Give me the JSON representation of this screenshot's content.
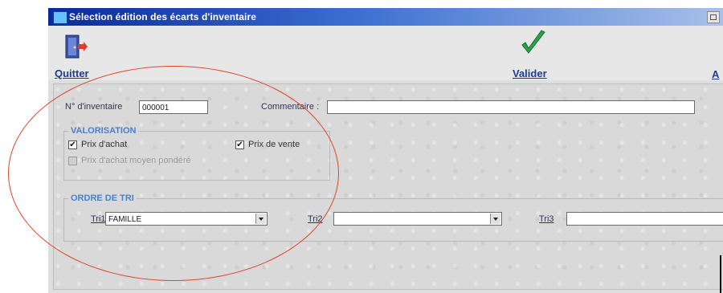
{
  "window": {
    "title": "Sélection édition des écarts d'inventaire"
  },
  "toolbar": {
    "quit_label": "Quitter",
    "quit_icon": "exit-door-icon",
    "validate_label": "Valider",
    "validate_icon": "green-checkmark-icon",
    "cut_off_label": "A"
  },
  "form": {
    "inventory_number": {
      "label": "N° d'inventaire",
      "value": "000001"
    },
    "comment": {
      "label": "Commentaire :",
      "value": ""
    },
    "valorisation": {
      "legend": "VALORISATION",
      "purchase_price": {
        "label": "Prix d'achat",
        "checked": true
      },
      "sale_price": {
        "label": "Prix de vente",
        "checked": true
      },
      "weighted_avg_price": {
        "label": "Prix d'achat moyen pondéré",
        "checked": false,
        "disabled": true
      }
    },
    "sort_order": {
      "legend": "ORDRE DE TRI",
      "sort1": {
        "label": "Tri1",
        "value": "FAMILLE"
      },
      "sort2": {
        "label": "Tri2",
        "value": ""
      },
      "sort3": {
        "label": "Tri3",
        "value": ""
      }
    }
  },
  "colors": {
    "titlebar_dark": "#0a2a9a",
    "legend_blue": "#4a7fd0",
    "toolbar_label": "#1c3d8f",
    "annotation_red": "#e0442c",
    "checkmark_green": "#2aa34a"
  },
  "check_mark": "✔"
}
